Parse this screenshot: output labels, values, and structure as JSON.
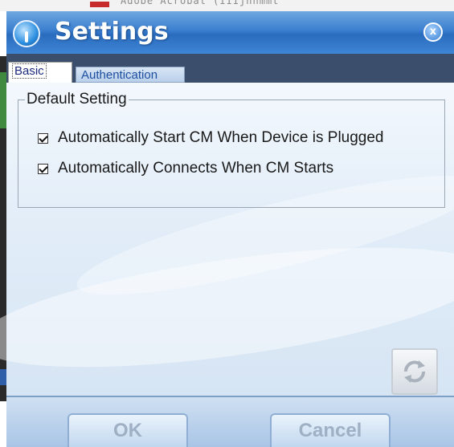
{
  "window": {
    "title": "Settings"
  },
  "background": {
    "partial_text": "Adobe Acrobat (IIIjnnmmt"
  },
  "tabs": [
    {
      "label": "Basic",
      "selected": true
    },
    {
      "label": "Authentication",
      "selected": false
    }
  ],
  "group": {
    "title": "Default Setting",
    "options": [
      {
        "label": "Automatically Start CM When Device is Plugged",
        "checked": true
      },
      {
        "label": "Automatically Connects When CM Starts",
        "checked": true
      }
    ]
  },
  "buttons": {
    "ok_label": "OK",
    "cancel_label": "Cancel"
  },
  "icons": {
    "app": "app-logo-icon",
    "close": "close-icon",
    "refresh": "refresh-icon"
  },
  "colors": {
    "titlebar": "#3b7fcf",
    "tabstrip": "#3b4f6d",
    "button_text": "#9fb0c5"
  }
}
